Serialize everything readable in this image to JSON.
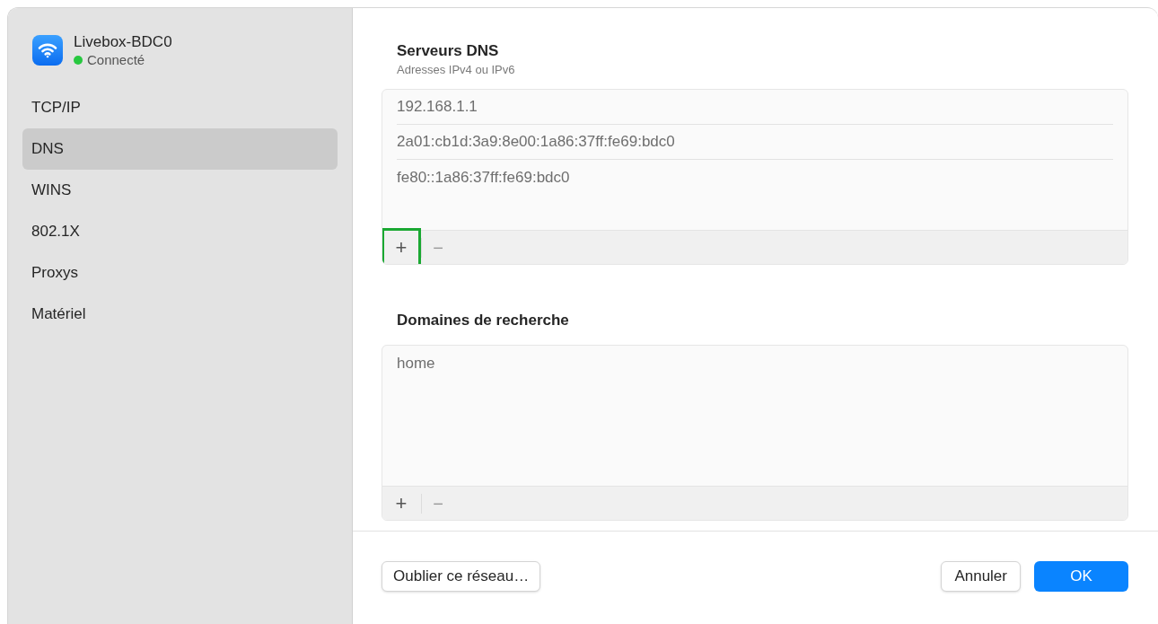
{
  "network": {
    "name": "Livebox-BDC0",
    "status": {
      "label": "Connecté",
      "color": "#28c840"
    }
  },
  "sidebar": {
    "items": [
      {
        "label": "TCP/IP",
        "selected": false
      },
      {
        "label": "DNS",
        "selected": true
      },
      {
        "label": "WINS",
        "selected": false
      },
      {
        "label": "802.1X",
        "selected": false
      },
      {
        "label": "Proxys",
        "selected": false
      },
      {
        "label": "Matériel",
        "selected": false
      }
    ]
  },
  "sections": [
    {
      "title": "Serveurs DNS",
      "subtitle": "Adresses IPv4 ou IPv6",
      "entries": [
        "192.168.1.1",
        "2a01:cb1d:3a9:8e00:1a86:37ff:fe69:bdc0",
        "fe80::1a86:37ff:fe69:bdc0"
      ],
      "add_button": {
        "label": "+",
        "highlighted": true
      },
      "remove_button": {
        "label": "−",
        "disabled": true
      }
    },
    {
      "title": "Domaines de recherche",
      "entries": [
        "home"
      ],
      "add_button": {
        "label": "+",
        "highlighted": false
      },
      "remove_button": {
        "label": "−",
        "disabled": true
      }
    }
  ],
  "footer": {
    "forget_button": "Oublier ce réseau…",
    "cancel_button": "Annuler",
    "ok_button": "OK"
  }
}
